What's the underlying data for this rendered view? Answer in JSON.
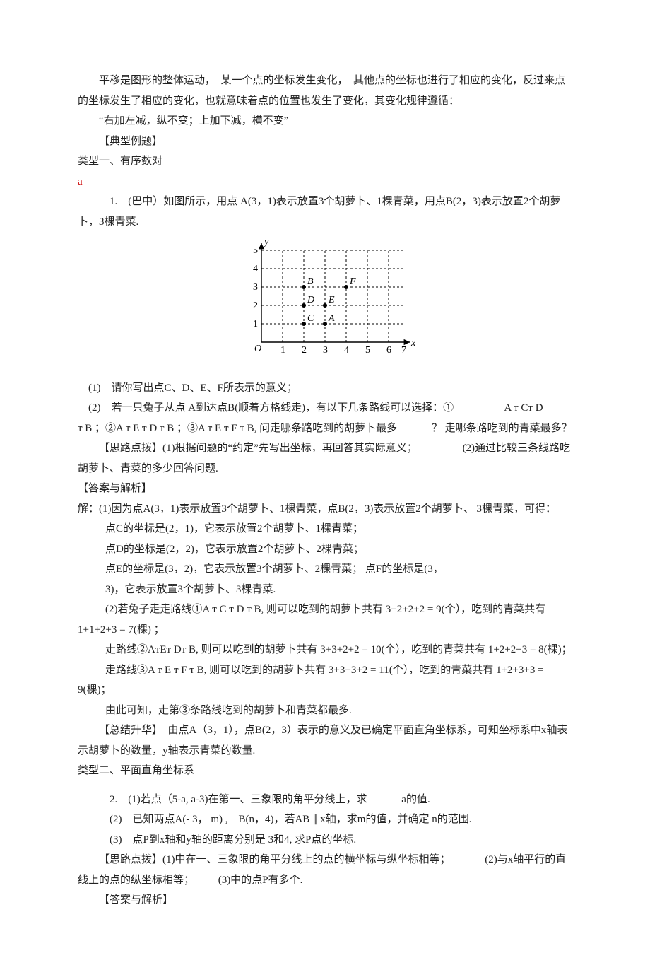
{
  "para": {
    "intro1": "平移是图形的整体运动，　某一个点的坐标发生变化，　其他点的坐标也进行了相应的变化，反过来点的坐标发生了相应的变化，也就意味着点的位置也发生了变化，其变化规律遵循：",
    "intro2": "“右加左减，纵不变；上加下减，横不变”",
    "sec_dx": "【典型例题】",
    "type1": "类型一、有序数对",
    "a": "a",
    "q1a": "1.　(巴中）如图所示，用点 A(3，1)表示放置3个胡萝卜、1棵青菜，用点B(2，3)表示放置2个胡萝卜，3棵青菜.",
    "q1_1": "(1)　请你写出点C、D、E、F所表示的意义；",
    "q1_2a": "(2)　若一只兔子从点 A到达点B(顺着方格线走)，有以下几条路线可以选择：①",
    "q1_2b": "A т Cт D",
    "q1_2c": "т B ；②A т E т D т B ；③A т E т F т B,  问走哪条路吃到的胡萝卜最多",
    "q1_2d": "？ 走哪条路吃到的青菜最多？",
    "hint1a": "【思路点拨】(1)根据问题的“约定”先写出坐标，再回答其实际意义；",
    "hint1b": "(2)通过比较三条线路吃胡萝卜、青菜的多少回答问题.",
    "ans_hdr": "【答案与解析】",
    "sol1": "解：(1)因为点A(3，1)表示放置3个胡萝卜、1棵青菜，点B(2，3)表示放置2个胡萝卜、 3棵青菜，可得：",
    "solC": "点C的坐标是(2，1)，它表示放置2个胡萝卜、1棵青菜；",
    "solD": "点D的坐标是(2，2)，它表示放置2个胡萝卜、2棵青菜；",
    "solE": "点E的坐标是(3，2)，它表示放置3个胡萝卜、2棵青菜； 点F的坐标是(3，",
    "solF": "3)，它表示放置3个胡萝卜、3棵青菜.",
    "sol2a": "(2)若兔子走走路线①A т C т D т B, 则可以吃到的胡萝卜共有 3+2+2+2 = 9(个），吃到的青菜共有1+1+2+3 = 7(棵) ；",
    "sol2b": "走路线②AтEт Dт B, 则可以吃到的胡萝卜共有 3+3+2+2 = 10(个），吃到的青菜共有 1+2+2+3 = 8(棵)；",
    "sol2c": "走路线③A т E т F т B, 则可以吃到的胡萝卜共有 3+3+3+2 = 11(个），吃到的青菜共有 1+2+3+3 = 9(棵)；",
    "sol2d": "由此可知，走第③条路线吃到的胡萝卜和青菜都最多.",
    "summary1": "【总结升华】　由点A（3，1），点B(2，3）表示的意义及已确定平面直角坐标系，可知坐标系中x轴表示胡萝卜的数量，y轴表示青菜的数量.",
    "type2": "类型二、平面直角坐标系",
    "q2_1a": "2.　(1)若点（5-a,  a-3)在第一、三象限的角平分线上，求",
    "q2_1b": "a的值.",
    "q2_2": "(2)　已知两点A(- 3， m) ,　B(n，4)，若AB ∥  x轴，求m的值，并确定 n的范围.",
    "q2_3": "(3)　点P到x轴和y轴的距离分别是 3和4, 求P点的坐标.",
    "hint2a": "【思路点拨】(1)中在一、三象限的角平分线上的点的横坐标与纵坐标相等；",
    "hint2b": "(2)与x轴平行的直线上的点的纵坐标相等；",
    "hint2c": "(3)中的点P有多个.",
    "ans_hdr2": "【答案与解析】"
  },
  "chart_data": {
    "type": "scatter",
    "title": "",
    "xlabel": "x",
    "ylabel": "y",
    "xlim": [
      0,
      7
    ],
    "ylim": [
      0,
      5
    ],
    "points": [
      {
        "name": "A",
        "x": 3,
        "y": 1
      },
      {
        "name": "B",
        "x": 2,
        "y": 3
      },
      {
        "name": "C",
        "x": 2,
        "y": 1
      },
      {
        "name": "D",
        "x": 2,
        "y": 2
      },
      {
        "name": "E",
        "x": 3,
        "y": 2
      },
      {
        "name": "F",
        "x": 4,
        "y": 3
      }
    ],
    "xticks": [
      1,
      2,
      3,
      4,
      5,
      6,
      7
    ],
    "yticks": [
      1,
      2,
      3,
      4,
      5
    ]
  }
}
